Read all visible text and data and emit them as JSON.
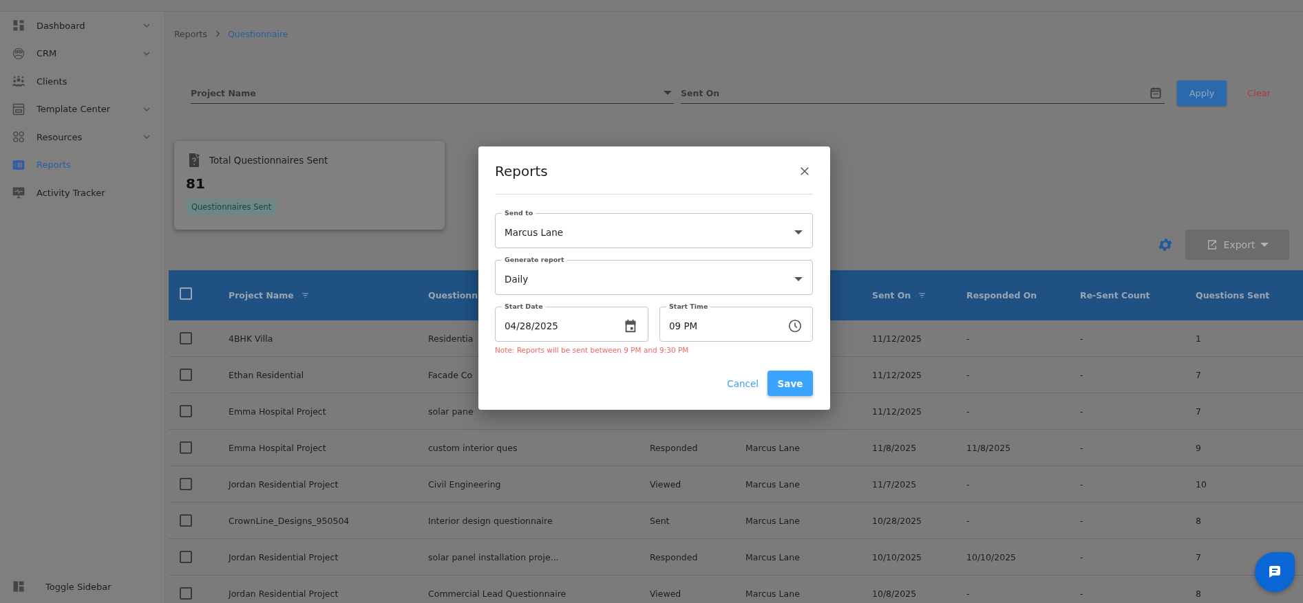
{
  "sidebar": {
    "items": [
      {
        "label": "Dashboard",
        "expandable": true,
        "selected": false
      },
      {
        "label": "CRM",
        "expandable": true,
        "selected": false
      },
      {
        "label": "Clients",
        "expandable": false,
        "selected": false
      },
      {
        "label": "Template Center",
        "expandable": true,
        "selected": false
      },
      {
        "label": "Resources",
        "expandable": true,
        "selected": false
      },
      {
        "label": "Reports",
        "expandable": false,
        "selected": true
      },
      {
        "label": "Activity Tracker",
        "expandable": false,
        "selected": false
      }
    ],
    "toggle": "Toggle Sidebar"
  },
  "breadcrumb": [
    {
      "label": "Reports",
      "current": false
    },
    {
      "label": "Questionnaire",
      "current": true
    }
  ],
  "filters": {
    "project_name": {
      "placeholder": "Project Name"
    },
    "sent_on": {
      "placeholder": "Sent On"
    },
    "apply": "Apply",
    "clear": "Clear"
  },
  "summary_card": {
    "title": "Total Questionnaires Sent",
    "value": "81",
    "tag": "Questionnaires Sent"
  },
  "toolbar": {
    "export": "Export",
    "export_disabled": true
  },
  "table": {
    "all_checked": false,
    "columns": {
      "project_name": {
        "label": "Project Name",
        "sortable": true
      },
      "column_2": {
        "label": "Questionn",
        "sortable": false
      },
      "sent_on": {
        "label": "Sent On",
        "sortable": true
      },
      "responded_on": {
        "label": "Responded On",
        "sortable": false
      },
      "re_sent_count": {
        "label": "Re-Sent Count",
        "sortable": false
      },
      "questions_sent": {
        "label": "Questions Sent",
        "sortable": false
      }
    },
    "rows": [
      {
        "checked": false,
        "project_name": "4BHK Villa",
        "column_2": "Residentia",
        "sent_on": "11/12/2025",
        "responded_on": "-",
        "re_sent_count": "-",
        "questions_sent": "1"
      },
      {
        "checked": false,
        "project_name": "Ethan Residential",
        "column_2": "Facade Co",
        "sent_on": "11/12/2025",
        "responded_on": "-",
        "re_sent_count": "-",
        "questions_sent": "7"
      },
      {
        "checked": false,
        "project_name": "Emma Hospital Project",
        "column_2": "solar pane",
        "sent_on": "11/12/2025",
        "responded_on": "-",
        "re_sent_count": "-",
        "questions_sent": "7"
      },
      {
        "checked": false,
        "project_name": "Emma Hospital Project",
        "column_2": "custom interior ques",
        "column_3": "Responded",
        "column_4": "Marcus Lane",
        "sent_on": "11/8/2025",
        "responded_on": "11/8/2025",
        "re_sent_count": "-",
        "questions_sent": "9"
      },
      {
        "checked": false,
        "project_name": "Jordan Residential Project",
        "column_2": "Civil Engineering",
        "column_3": "Viewed",
        "column_4": "Marcus Lane",
        "sent_on": "11/7/2025",
        "responded_on": "-",
        "re_sent_count": "-",
        "questions_sent": "10"
      },
      {
        "checked": false,
        "project_name": "CrownLine_Designs_950504",
        "column_2": "Interior design questionnaire",
        "column_3": "Sent",
        "column_4": "Marcus Lane",
        "sent_on": "10/28/2025",
        "responded_on": "-",
        "re_sent_count": "-",
        "questions_sent": "8"
      },
      {
        "checked": false,
        "project_name": "Jordan Residential Project",
        "column_2": "solar panel installation proje...",
        "column_3": "Responded",
        "column_4": "Marcus Lane",
        "sent_on": "10/10/2025",
        "responded_on": "10/10/2025",
        "re_sent_count": "-",
        "questions_sent": "7"
      },
      {
        "checked": false,
        "project_name": "Jordan Residential Project",
        "column_2": "Commercial Lead Questionnaire",
        "column_3": "Viewed",
        "column_4": "Marcus Lane",
        "sent_on": "10/8/2025",
        "responded_on": "-",
        "re_sent_count": "-",
        "questions_sent": "8"
      }
    ]
  },
  "dialog": {
    "title": "Reports",
    "send_to": {
      "label": "Send to",
      "value": "Marcus Lane"
    },
    "generate_report": {
      "label": "Generate report",
      "value": "Daily"
    },
    "start_date": {
      "label": "Start Date",
      "value": "04/28/2025"
    },
    "start_time": {
      "label": "Start Time",
      "value": "09 PM"
    },
    "note": "Note: Reports will be sent between 9 PM and 9:30 PM",
    "cancel": "Cancel",
    "save": "Save"
  }
}
